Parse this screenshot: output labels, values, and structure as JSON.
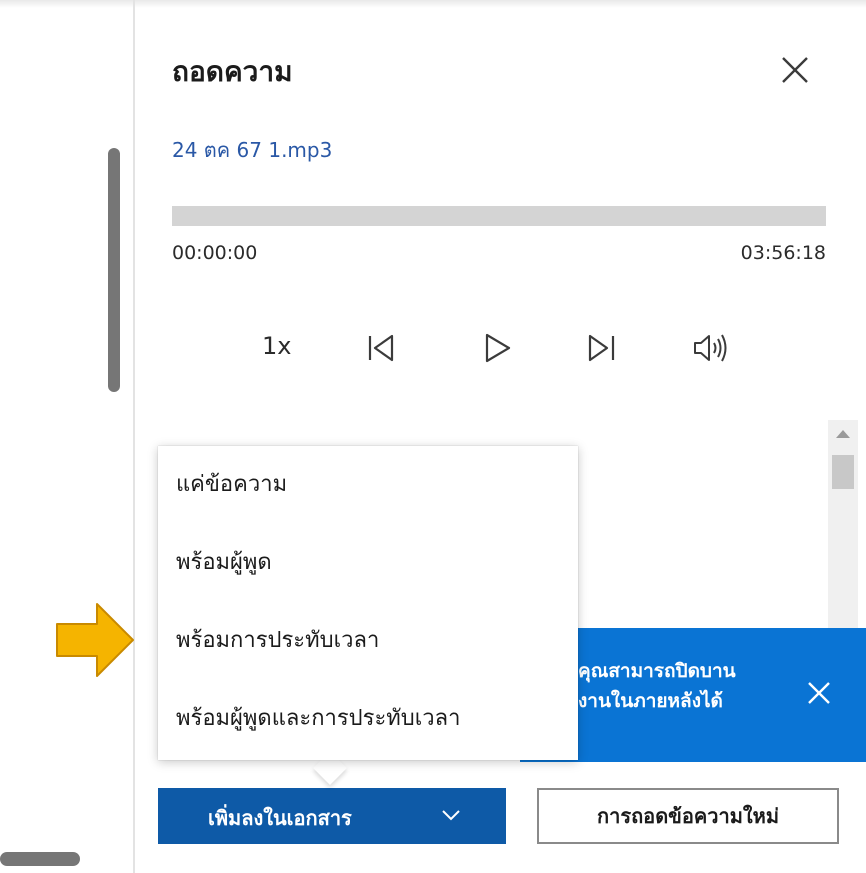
{
  "panel": {
    "title": "ถอดความ",
    "file_name": "24 ตค 67 1.mp3"
  },
  "player": {
    "time_start": "00:00:00",
    "time_end": "03:56:18",
    "progress": 0,
    "speed": "1x",
    "icons": [
      "skip-back-icon",
      "play-icon",
      "skip-forward-icon",
      "volume-icon"
    ]
  },
  "dropdown": {
    "items": [
      "แค่ข้อความ",
      "พร้อมผู้พูด",
      "พร้อมการประทับเวลา",
      "พร้อมผู้พูดและการประทับเวลา"
    ]
  },
  "toast": {
    "line1": "คุณสามารถปิดบาน",
    "line2": "งานในภายหลังได้"
  },
  "footer": {
    "add_to_document": "เพิ่มลงในเอกสาร",
    "new_transcription": "การถอดข้อความใหม่"
  },
  "colors": {
    "accent": "#0e5aa7",
    "link": "#2a58a6",
    "toast": "#0a74d4",
    "annotation_arrow": "#f5b400"
  }
}
